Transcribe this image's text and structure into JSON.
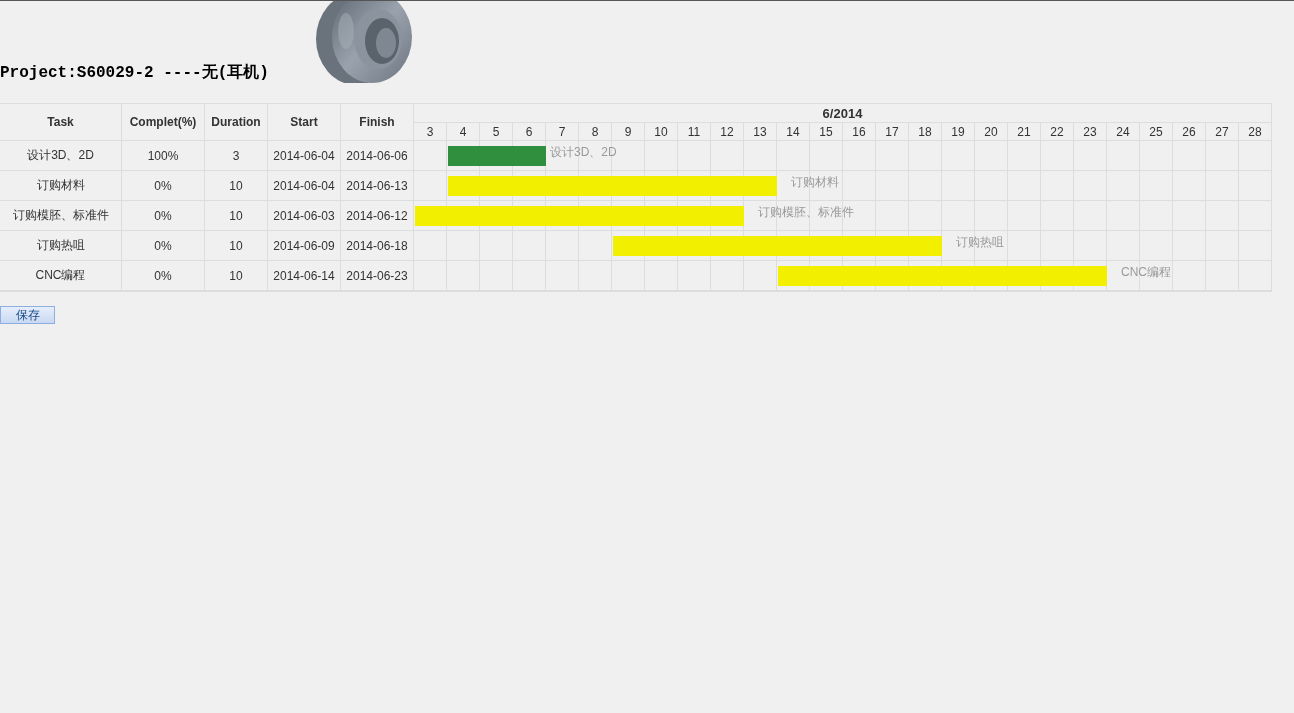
{
  "title": "Project:S60029-2 ----无(耳机)",
  "table": {
    "columns": [
      "Task",
      "Complet(%)",
      "Duration",
      "Start",
      "Finish"
    ],
    "month": "6/2014",
    "days": [
      "3",
      "4",
      "5",
      "6",
      "7",
      "8",
      "9",
      "10",
      "11",
      "12",
      "13",
      "14",
      "15",
      "16",
      "17",
      "18",
      "19",
      "20",
      "21",
      "22",
      "23",
      "24",
      "25",
      "26",
      "27",
      "28"
    ],
    "rows": [
      {
        "task": "设计3D、2D",
        "complete": "100%",
        "duration": "3",
        "start": "2014-06-04",
        "finish": "2014-06-06",
        "done": true,
        "bar_label": "设计3D、2D"
      },
      {
        "task": "订购材料",
        "complete": "0%",
        "duration": "10",
        "start": "2014-06-04",
        "finish": "2014-06-13",
        "done": false,
        "bar_label": "订购材料"
      },
      {
        "task": "订购模胚、标准件",
        "complete": "0%",
        "duration": "10",
        "start": "2014-06-03",
        "finish": "2014-06-12",
        "done": false,
        "bar_label": "订购模胚、标准件"
      },
      {
        "task": "订购热咀",
        "complete": "0%",
        "duration": "10",
        "start": "2014-06-09",
        "finish": "2014-06-18",
        "done": false,
        "bar_label": "订购热咀"
      },
      {
        "task": "CNC编程",
        "complete": "0%",
        "duration": "10",
        "start": "2014-06-14",
        "finish": "2014-06-23",
        "done": false,
        "bar_label": "CNC编程"
      }
    ]
  },
  "save_button": "保存"
}
